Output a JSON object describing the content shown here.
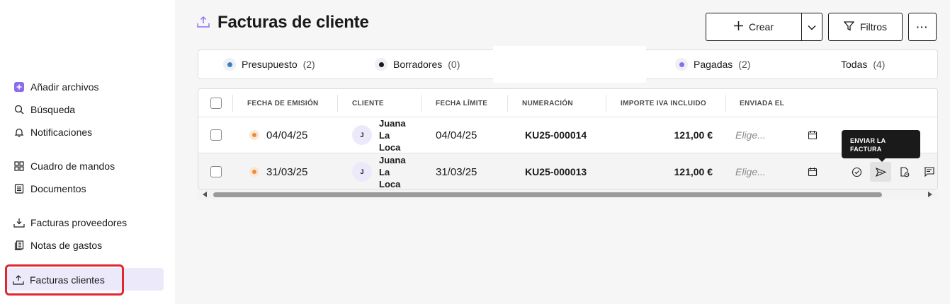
{
  "sidebar": {
    "items": [
      {
        "label": "Añadir archivos",
        "icon": "plus-square-icon"
      },
      {
        "label": "Búsqueda",
        "icon": "search-icon"
      },
      {
        "label": "Notificaciones",
        "icon": "bell-icon"
      },
      {
        "label": "Cuadro de mandos",
        "icon": "grid-icon"
      },
      {
        "label": "Documentos",
        "icon": "document-icon"
      },
      {
        "label": "Facturas proveedores",
        "icon": "download-tray-icon"
      },
      {
        "label": "Notas de gastos",
        "icon": "receipts-icon"
      },
      {
        "label": "Facturas clientes",
        "icon": "upload-tray-icon",
        "active": true
      }
    ]
  },
  "header": {
    "title": "Facturas de cliente",
    "crear_label": "Crear",
    "filtros_label": "Filtros",
    "more_label": "···"
  },
  "tabs": [
    {
      "label": "Presupuesto",
      "count": "(2)",
      "dot_color": "#3b82c4"
    },
    {
      "label": "Borradores",
      "count": "(0)",
      "dot_color": "#1a1a1a"
    },
    {
      "label": "Pagadas",
      "count": "(2)",
      "dot_color": "#8b6cf0"
    },
    {
      "label": "Todas",
      "count": "(4)"
    }
  ],
  "table": {
    "columns": [
      "FECHA DE EMISIÓN",
      "CLIENTE",
      "FECHA LÍMITE",
      "NUMERACIÓN",
      "IMPORTE IVA INCLUIDO",
      "ENVIADA EL"
    ],
    "rows": [
      {
        "fecha_emision": "04/04/25",
        "client_initial": "J",
        "cliente": "Juana La Loca",
        "fecha_limite": "04/04/25",
        "numeracion": "KU25-000014",
        "importe": "121,00 €",
        "enviada_el": "Elige..."
      },
      {
        "fecha_emision": "31/03/25",
        "client_initial": "J",
        "cliente": "Juana La Loca",
        "fecha_limite": "31/03/25",
        "numeracion": "KU25-000013",
        "importe": "121,00 €",
        "enviada_el": "Elige..."
      }
    ]
  },
  "tooltip": {
    "text": "ENVIAR LA FACTURA"
  },
  "colors": {
    "accent": "#6b4ee6",
    "active_bg": "#ece9fb",
    "status_orange": "#f08a3a",
    "highlight_red": "#e3262e"
  }
}
